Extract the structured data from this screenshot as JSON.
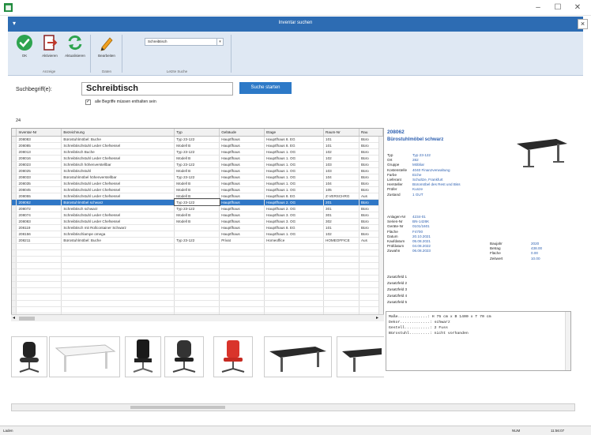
{
  "window": {
    "title": "Inventar suchen",
    "minimize": "–",
    "maximize": "☐",
    "close": "✕",
    "ribbon_close": "×",
    "ribbon_caret": "▾"
  },
  "ribbon": {
    "buttons": [
      {
        "label": "OK",
        "icon": "ok-check-icon"
      },
      {
        "label": "Aktivieren",
        "icon": "activate-door-icon"
      },
      {
        "label": "Aktualisieren",
        "icon": "refresh-icon"
      },
      {
        "label": "Bearbeiten",
        "icon": "edit-pencil-icon"
      }
    ],
    "groups": [
      "Anzeige",
      "Daten",
      "Letzte Suche"
    ],
    "last_search_value": "Schreibtisch",
    "colors": {
      "accent": "#2d6cb3",
      "ok_green": "#2ea44f",
      "edit_orange": "#f2a01e",
      "activate_red": "#c0392b"
    }
  },
  "search": {
    "label": "Suchbegriff(e):",
    "value": "Schreibtisch",
    "button": "Suche starten",
    "all_terms_label": "alle Begriffe müssen enthalten sein",
    "all_terms_checked": "✓"
  },
  "result_count": "24",
  "table": {
    "columns": [
      "Inventar-Nr",
      "Bezeichnung",
      "Typ",
      "Gebäude",
      "Etage",
      "Raum-Nr",
      "Rau"
    ],
    "selected_index": 13,
    "rows": [
      [
        "208083",
        "Bürostuhlmöbel: Buche",
        "Typ 23-122",
        "Hauptfhaus",
        "Hauptfhaus 8. EG",
        "101",
        "Büro"
      ],
      [
        "208085",
        "Schreibtischstuhl Leder Chefsessel",
        "Modell B",
        "Hauptfhaus",
        "Hauptfhaus 8. EG",
        "101",
        "Büro"
      ],
      [
        "208013",
        "Schreibtisch Buche",
        "Typ 23-122",
        "Hauptfhaus",
        "Hauptfhaus 1. OG",
        "102",
        "Büro"
      ],
      [
        "208016",
        "Schreibtischstuhl Leder Chefsessel",
        "Modell B",
        "Hauptfhaus",
        "Hauptfhaus 1. OG",
        "102",
        "Büro"
      ],
      [
        "208023",
        "Schreibtisch höhenverstellbar",
        "Typ 23-122",
        "Hauptfhaus",
        "Hauptfhaus 1. OG",
        "103",
        "Büro"
      ],
      [
        "208025",
        "Schreibtischstuhl",
        "Modell B",
        "Hauptfhaus",
        "Hauptfhaus 1. OG",
        "103",
        "Büro"
      ],
      [
        "208033",
        "Bürostuhlmöbel höhenverstellbar",
        "Typ 23-122",
        "Hauptfhaus",
        "Hauptfhaus 1. OG",
        "104",
        "Büro"
      ],
      [
        "208035",
        "Schreibtischstuhl Leder Chefsessel",
        "Modell B",
        "Hauptfhaus",
        "Hauptfhaus 1. OG",
        "104",
        "Büro"
      ],
      [
        "208045",
        "Schreibtischstuhl Leder Chefsessel",
        "Modell B",
        "Hauptfhaus",
        "Hauptfhaus 1. OG",
        "105",
        "Büro"
      ],
      [
        "208055",
        "Schreibtischstuhl Leder Chefsessel",
        "Modell B",
        "Hauptfhaus",
        "Hauptfhaus 8. EG",
        "Z-VERSCHRG",
        "Aus"
      ],
      [
        "208062",
        "Bürostuhlmöbel schwarz",
        "Typ 23-122",
        "Hauptfhaus",
        "Hauptfhaus 2. OG",
        "201",
        "Büro"
      ],
      [
        "208072",
        "Schreibtisch schwarz",
        "Typ 23-122",
        "Hauptfhaus",
        "Hauptfhaus 2. OG",
        "301",
        "Büro"
      ],
      [
        "208074",
        "Schreibtischstuhl Leder Chefsessel",
        "Modell B",
        "Hauptfhaus",
        "Hauptfhaus 3. OG",
        "301",
        "Büro"
      ],
      [
        "208083",
        "Schreibtischstuhl Leder Chefsessel",
        "Modell B",
        "Hauptfhaus",
        "Hauptfhaus 3. OG",
        "302",
        "Büro"
      ],
      [
        "208119",
        "Schreibtisch mit Rollcontainer Schwarz",
        "",
        "Hauptfhaus",
        "Hauptfhaus 8. EG",
        "101",
        "Büro"
      ],
      [
        "208156",
        "Schreibtischlampe omega",
        "",
        "Hauptfhaus",
        "Hauptfhaus 1. OG",
        "102",
        "Büro"
      ],
      [
        "208211",
        "Bürostuhlmöbel: Buche",
        "Typ 23-122",
        "Privat",
        "Homeoffice",
        "HOMEOFFICE",
        "Aus"
      ]
    ],
    "empty_rows": 13
  },
  "detail": {
    "number": "208062",
    "title": "Bürostuhlmöbel schwarz",
    "fields": [
      {
        "label": "Typ",
        "value": "Typ 23-122"
      },
      {
        "label": "Ort",
        "value": "282"
      },
      {
        "label": "Gruppe",
        "value": "Möbliar"
      },
      {
        "label": "Kostenstelle",
        "value": "4040 Finanzverwaltung"
      },
      {
        "label": "Farbe",
        "value": "Eiche"
      },
      {
        "label": "Lieferant",
        "value": "Schultze, Frankfurt"
      },
      {
        "label": "Hersteller",
        "value": "Büromöbel des Rest und Biss"
      },
      {
        "label": "Prüfer",
        "value": "Kunze"
      },
      {
        "label": "Zustand",
        "value": "1 GUT"
      }
    ],
    "fields2": [
      {
        "label": "Anlagen-Nr",
        "value": "4234-01"
      },
      {
        "label": "Serien-Nr",
        "value": "BN-1426K"
      },
      {
        "label": "Geräte-Nr",
        "value": "0101/1601"
      },
      {
        "label": "Fläche",
        "value": "F4700"
      },
      {
        "label": "Datum",
        "value": "20.10.2021"
      },
      {
        "label": "Kaufdatum",
        "value": "05.08.2021"
      },
      {
        "label": "Prüfdatum",
        "value": "04.08.2022"
      },
      {
        "label": "Zuwahn",
        "value": "06.08.2023"
      }
    ],
    "fields3": [
      {
        "label": "Baujahr",
        "value": "2020"
      },
      {
        "label": "Betrag",
        "value": "438.00"
      },
      {
        "label": "Fläche",
        "value": "0.00"
      },
      {
        "label": "Zeitwert",
        "value": "10.00"
      }
    ],
    "extra_fields": [
      "Zusatzfeld 1",
      "Zusatzfeld 2",
      "Zusatzfeld 3",
      "Zusatzfeld 4",
      "Zusatzfeld 5"
    ],
    "notes": [
      "Maße.............: H 75 cm x B 1400 x T 70 cm",
      "Dekor.............: schwarz",
      "Gestell...........: 2 Fuss",
      "Bürostuhl.........: nicht vorhanden"
    ]
  },
  "thumbnails": [
    "office-chair-black",
    "white-desk",
    "executive-chair-black",
    "mesh-chair",
    "red-chair",
    "black-desk-electric",
    "black-desk-side"
  ],
  "status": {
    "left": "Laden",
    "right1": "NUM",
    "right2": "11:56:07"
  }
}
